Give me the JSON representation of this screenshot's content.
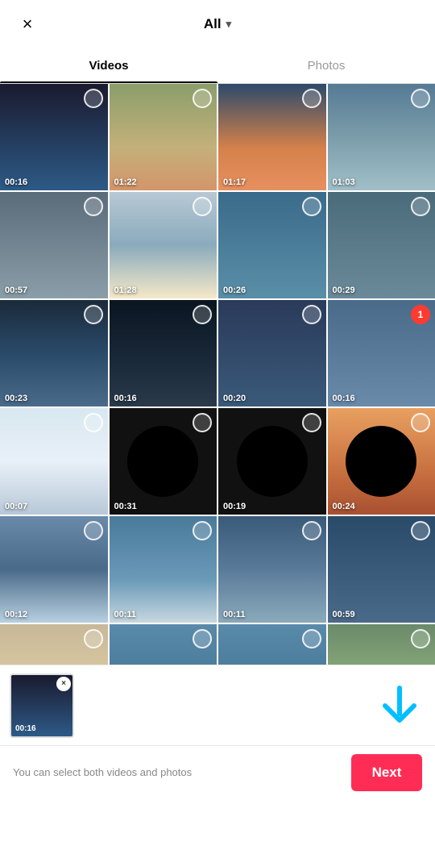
{
  "header": {
    "filter_label": "All",
    "close_icon": "×",
    "chevron": "▾"
  },
  "tabs": [
    {
      "id": "videos",
      "label": "Videos",
      "active": true
    },
    {
      "id": "photos",
      "label": "Photos",
      "active": false
    }
  ],
  "grid": {
    "items": [
      {
        "id": 1,
        "duration": "00:16",
        "selected": false,
        "row": 1,
        "colorClass": "thumb-dark-aerial"
      },
      {
        "id": 2,
        "duration": "01:22",
        "selected": false,
        "row": 1,
        "colorClass": "thumb-aerial-land"
      },
      {
        "id": 3,
        "duration": "01:17",
        "selected": false,
        "row": 1,
        "colorClass": "thumb-feet-orange"
      },
      {
        "id": 4,
        "duration": "01:03",
        "selected": false,
        "row": 1,
        "colorClass": "thumb-aerial-coast"
      },
      {
        "id": 5,
        "duration": "00:57",
        "selected": false,
        "row": 2,
        "colorClass": "thumb-grey-blue"
      },
      {
        "id": 6,
        "duration": "01:28",
        "selected": false,
        "row": 2,
        "colorClass": "thumb-bright-aerial"
      },
      {
        "id": 7,
        "duration": "00:26",
        "selected": false,
        "row": 2,
        "colorClass": "thumb-blue-water"
      },
      {
        "id": 8,
        "duration": "00:29",
        "selected": false,
        "row": 2,
        "colorClass": "thumb-blue-grey"
      },
      {
        "id": 9,
        "duration": "00:23",
        "selected": false,
        "row": 3,
        "colorClass": "thumb-plane-wing"
      },
      {
        "id": 10,
        "duration": "00:16",
        "selected": false,
        "row": 3,
        "colorClass": "thumb-plane-dark"
      },
      {
        "id": 11,
        "duration": "00:20",
        "selected": false,
        "row": 3,
        "colorClass": "thumb-plane-blue"
      },
      {
        "id": 12,
        "duration": "00:16",
        "selected": true,
        "selectedNum": 1,
        "row": 3,
        "colorClass": "thumb-blue-haze"
      },
      {
        "id": 13,
        "duration": "00:07",
        "selected": false,
        "row": 4,
        "colorClass": "thumb-ski",
        "privacy": false
      },
      {
        "id": 14,
        "duration": "00:31",
        "selected": false,
        "row": 4,
        "colorClass": "thumb-black-circle",
        "privacy": true
      },
      {
        "id": 15,
        "duration": "00:19",
        "selected": false,
        "row": 4,
        "colorClass": "thumb-black-circle",
        "privacy": true
      },
      {
        "id": 16,
        "duration": "00:24",
        "selected": false,
        "row": 4,
        "colorClass": "thumb-orange-water",
        "privacy": true
      },
      {
        "id": 17,
        "duration": "00:12",
        "selected": false,
        "row": 5,
        "colorClass": "thumb-sea-splash"
      },
      {
        "id": 18,
        "duration": "00:11",
        "selected": false,
        "row": 5,
        "colorClass": "thumb-sea-boat"
      },
      {
        "id": 19,
        "duration": "00:11",
        "selected": false,
        "row": 5,
        "colorClass": "thumb-sea-animal"
      },
      {
        "id": 20,
        "duration": "00:59",
        "selected": false,
        "row": 5,
        "colorClass": "thumb-sea-dark"
      },
      {
        "id": 21,
        "duration": "",
        "selected": false,
        "row": 6,
        "colorClass": "thumb-beach-partial",
        "partial": true
      },
      {
        "id": 22,
        "duration": "",
        "selected": true,
        "row": 6,
        "colorClass": "thumb-sea-blue",
        "partial": true
      },
      {
        "id": 23,
        "duration": "",
        "selected": false,
        "row": 6,
        "colorClass": "thumb-sea-blue",
        "partial": true
      },
      {
        "id": 24,
        "duration": "",
        "selected": false,
        "row": 6,
        "colorClass": "thumb-tree-people",
        "partial": true
      }
    ]
  },
  "selected_preview": {
    "duration": "00:16",
    "remove_label": "×"
  },
  "action_bar": {
    "hint": "You can select both videos and photos",
    "next_label": "Next"
  }
}
